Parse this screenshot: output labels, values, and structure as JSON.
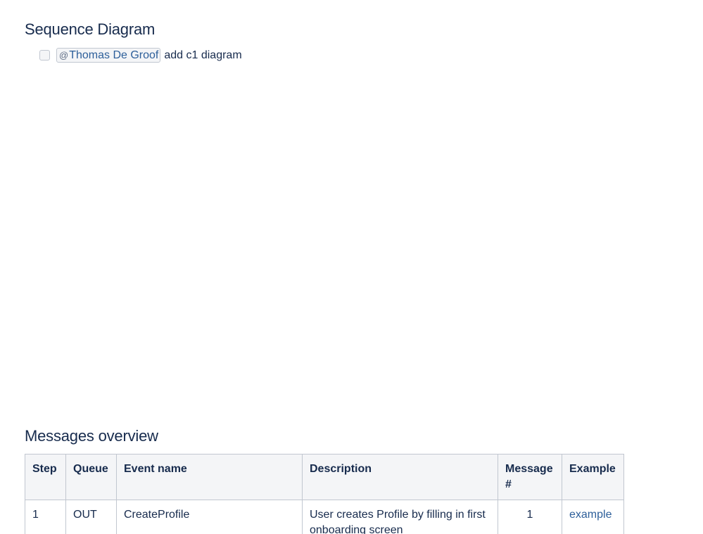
{
  "sections": {
    "sequence_heading": "Sequence Diagram",
    "messages_heading": "Messages overview"
  },
  "task": {
    "checked": false,
    "mention_at": "@",
    "mention_name": "Thomas De Groof",
    "text": "add c1 diagram"
  },
  "table": {
    "headers": [
      "Step",
      "Queue",
      "Event name",
      "Description",
      "Message #",
      "Example"
    ],
    "rows": [
      {
        "step": "1",
        "queue": "OUT",
        "event_name": "CreateProfile",
        "description": "User creates Profile by filling in first onboarding screen",
        "message_no": "1",
        "example": "example"
      }
    ]
  }
}
